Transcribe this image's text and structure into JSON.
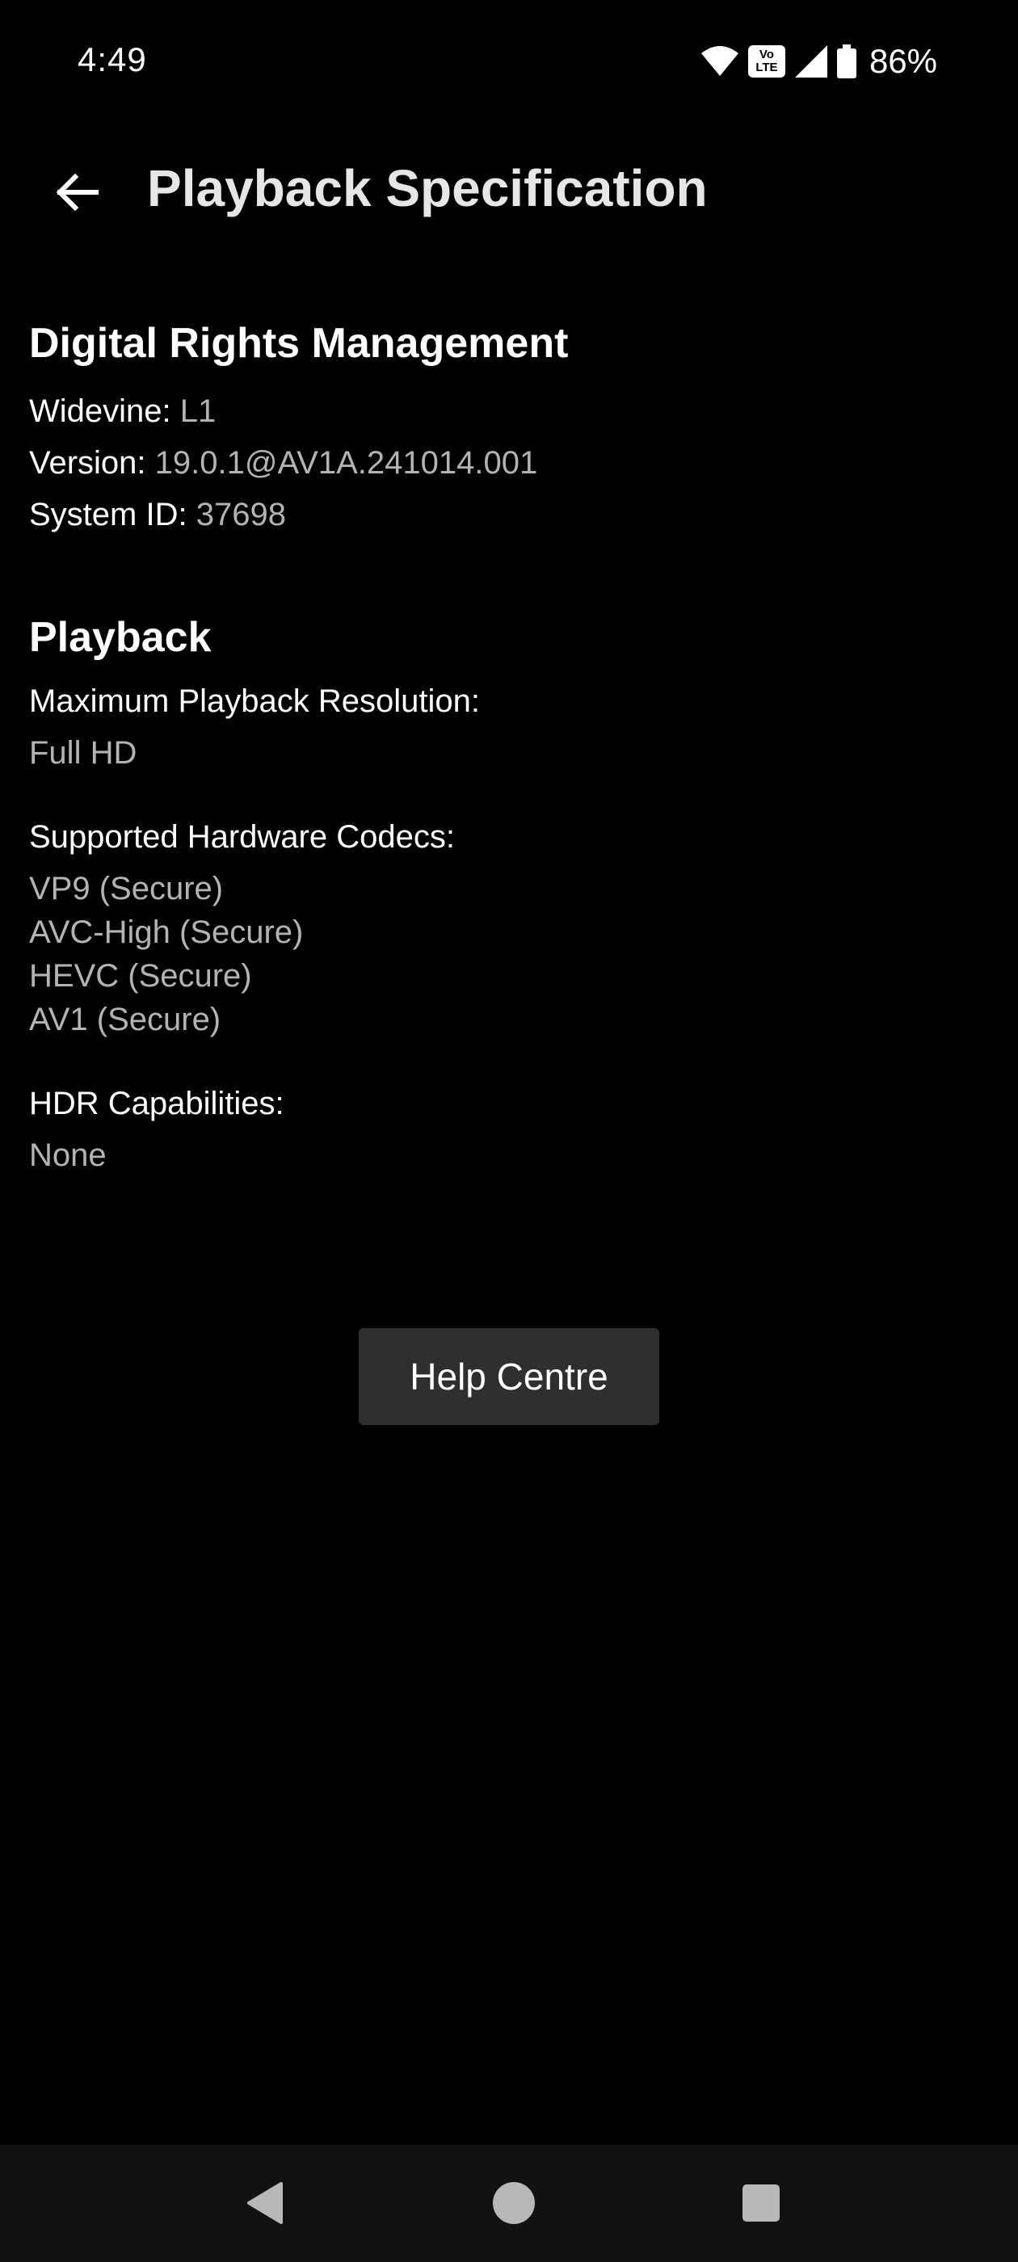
{
  "status_bar": {
    "time": "4:49",
    "battery": "86%",
    "icons": [
      "wifi-icon",
      "volte-icon",
      "signal-icon",
      "battery-icon"
    ],
    "volte_top": "Vo",
    "volte_bottom": "LTE"
  },
  "app_bar": {
    "title": "Playback Specification",
    "back_icon": "arrow-left-icon"
  },
  "drm": {
    "heading": "Digital Rights Management",
    "widevine_label": "Widevine:",
    "widevine_value": "L1",
    "version_label": "Version:",
    "version_value": "19.0.1@AV1A.241014.001",
    "system_id_label": "System ID:",
    "system_id_value": "37698"
  },
  "playback": {
    "heading": "Playback",
    "max_resolution_label": "Maximum Playback Resolution:",
    "max_resolution_value": "Full HD",
    "codecs_label": "Supported Hardware Codecs:",
    "codecs": [
      "VP9 (Secure)",
      "AVC-High (Secure)",
      "HEVC (Secure)",
      "AV1 (Secure)"
    ],
    "hdr_label": "HDR Capabilities:",
    "hdr_value": "None"
  },
  "help_button": {
    "label": "Help Centre"
  },
  "nav_bar": {
    "icons": [
      "nav-back-icon",
      "nav-home-icon",
      "nav-recents-icon"
    ]
  },
  "colors": {
    "background": "#000000",
    "primary_text": "#ffffff",
    "secondary_text": "#b3b3b3",
    "button_bg": "#2f2f2f",
    "nav_bg": "#121212"
  }
}
